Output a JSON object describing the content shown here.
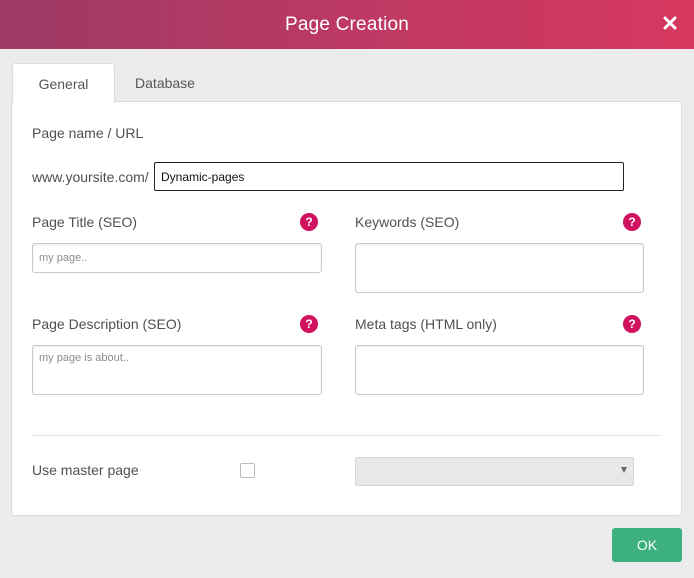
{
  "dialog": {
    "title": "Page Creation",
    "header_color_start": "#9c3a64",
    "header_color_end": "#d6385f"
  },
  "tabs": [
    {
      "label": "General",
      "active": true
    },
    {
      "label": "Database",
      "active": false
    }
  ],
  "form": {
    "page_name_label": "Page name / URL",
    "url_prefix": "www.yoursite.com/",
    "url_value": "Dynamic-pages",
    "page_title_label": "Page Title (SEO)",
    "page_title_placeholder": "my page..",
    "keywords_label": "Keywords (SEO)",
    "page_description_label": "Page Description (SEO)",
    "page_description_placeholder": "my page is about..",
    "meta_tags_label": "Meta tags (HTML only)",
    "help_glyph": "?",
    "master_page_label": "Use master page",
    "master_page_checked": false,
    "master_page_select_value": ""
  },
  "footer": {
    "ok_label": "OK",
    "ok_color": "#3cb17f"
  },
  "colors": {
    "help_icon": "#d0125f"
  }
}
